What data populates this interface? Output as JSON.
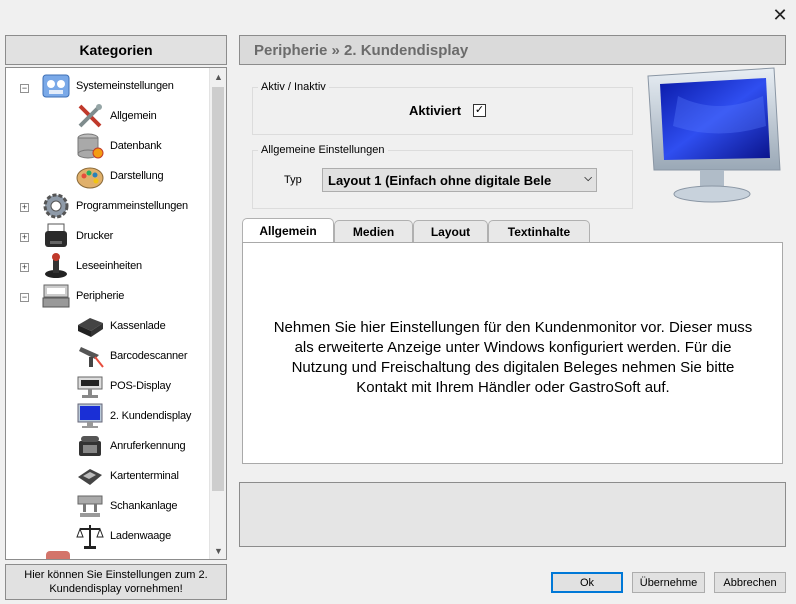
{
  "window": {
    "close_glyph": "✕"
  },
  "sidebar": {
    "title": "Kategorien",
    "items": [
      {
        "label": "Systemeinstellungen",
        "icon": "system-settings-icon",
        "expander": "⊟"
      },
      {
        "label": "Allgemein",
        "icon": "tools-icon"
      },
      {
        "label": "Datenbank",
        "icon": "database-icon"
      },
      {
        "label": "Darstellung",
        "icon": "palette-icon"
      },
      {
        "label": "Programmeinstellungen",
        "icon": "gear-icon",
        "expander": "⊞"
      },
      {
        "label": "Drucker",
        "icon": "printer-icon",
        "expander": "⊞"
      },
      {
        "label": "Leseeinheiten",
        "icon": "reader-icon",
        "expander": "⊞"
      },
      {
        "label": "Peripherie",
        "icon": "peripherals-icon",
        "expander": "⊟"
      },
      {
        "label": "Kassenlade",
        "icon": "cash-drawer-icon"
      },
      {
        "label": "Barcodescanner",
        "icon": "barcode-scanner-icon"
      },
      {
        "label": "POS-Display",
        "icon": "pos-display-icon"
      },
      {
        "label": "2. Kundendisplay",
        "icon": "monitor-icon"
      },
      {
        "label": "Anruferkennung",
        "icon": "phone-icon"
      },
      {
        "label": "Kartenterminal",
        "icon": "card-terminal-icon"
      },
      {
        "label": "Schankanlage",
        "icon": "tap-system-icon"
      },
      {
        "label": "Ladenwaage",
        "icon": "scale-icon"
      }
    ],
    "footer": "Hier können Sie Einstellungen zum 2. Kundendisplay vornehmen!"
  },
  "main": {
    "breadcrumb": "Peripherie » 2. Kundendisplay",
    "active_group": {
      "legend": "Aktiv / Inaktiv",
      "label": "Aktiviert",
      "checked": true,
      "check_glyph": "✓"
    },
    "general_group": {
      "legend": "Allgemeine Einstellungen",
      "type_label": "Typ",
      "type_value": "Layout 1 (Einfach ohne digitale Bele"
    },
    "tabs": [
      {
        "label": "Allgemein",
        "active": true
      },
      {
        "label": "Medien",
        "active": false
      },
      {
        "label": "Layout",
        "active": false
      },
      {
        "label": "Textinhalte",
        "active": false
      }
    ],
    "tab_text": "Nehmen Sie hier Einstellungen für den Kundenmonitor vor. Dieser muss als erweiterte Anzeige unter Windows konfiguriert werden. Für die Nutzung und Freischaltung des digitalen Beleges nehmen Sie bitte Kontakt mit Ihrem Händler oder GastroSoft auf."
  },
  "buttons": {
    "ok": "Ok",
    "apply": "Übernehme",
    "cancel": "Abbrechen"
  },
  "colors": {
    "accent": "#0078d7",
    "monitor_screen": "#1a2fd6"
  }
}
